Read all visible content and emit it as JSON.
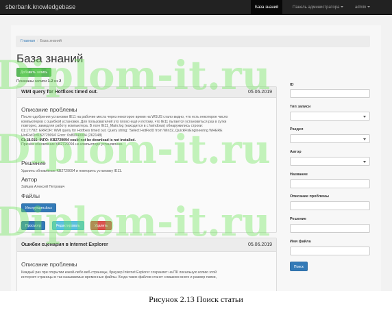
{
  "navbar": {
    "brand": "sberbank.knowledgebase",
    "items": [
      {
        "label": "База знаний",
        "active": true
      },
      {
        "label": "Панель администратора",
        "dropdown": true
      },
      {
        "label": "admin",
        "dropdown": true
      }
    ]
  },
  "breadcrumb": {
    "home": "Главная",
    "separator": "/",
    "current": "База знаний"
  },
  "page_title": "База знаний",
  "add_button": "Добавить запись",
  "shown": {
    "prefix": "Показаны записи",
    "range": "1-2",
    "of": "из",
    "total": "2"
  },
  "articles": [
    {
      "title": "WMI query for Hotfixes timed out.",
      "date": "05.06.2019",
      "problem_heading": "Описание проблемы",
      "problem_lines": [
        "После одобрения установки IE11 на рабочие места через некоторое время на WSUS стало видно, что есть некоторое число",
        "компьютеров с ошибкой установки. Для пользователей это плохо ещё и потому, что IE11 пытается установиться раз в сутки",
        "повторно, замедляя работу компьютера. В логе IE11_Main.log (находится в c:\\windows) обнаружились строки:",
        "01:17:782: ERROR: WMI query for Hotfixes timed out. Query string: 'Select HotFixID from Win32_QuickFixEngineering WHERE",
        "HotFixID=KB2729094' Error: 0x80040004 (262148)"
      ],
      "problem_bold_line": "01:18.016: INFO: KB2729094 could not be download is not installed.",
      "problem_cause_line": "Причём обновление KB2729094 на компьютере установлено.",
      "solution_heading": "Решение",
      "solution_text": "Удалить обновление KB2729094 и повторить установку IE11.",
      "author_heading": "Автор",
      "author_name": "Зайцев Алексей Петрович",
      "files_heading": "Файлы",
      "file_button": "Инструкция.docx",
      "view_button": "Просмотр",
      "edit_button": "Редактировать",
      "delete_button": "Удалить"
    },
    {
      "title": "Ошибки сценария в Internet Explorer",
      "date": "05.06.2019",
      "problem_heading": "Описание проблемы",
      "problem_lines": [
        "Каждый раз при открытии какой-либо веб-страницы, браузер Internet Explorer сохраняет на ПК локальную копию этой",
        "интернет-страницы в так называемые временные файлы. Когда таких файлов станет слишком много и размер папки,"
      ]
    }
  ],
  "search": {
    "fields": [
      "ID",
      "Тип записи",
      "Раздел",
      "Автор",
      "Название",
      "Описание проблемы",
      "Решение",
      "Имя файла"
    ],
    "button": "Поиск"
  },
  "watermark": [
    "Diplom-it.ru",
    "Diplom-it.ru",
    "Diplom-it.ru"
  ],
  "caption": "Рисунок 2.13 Поиск статьи"
}
